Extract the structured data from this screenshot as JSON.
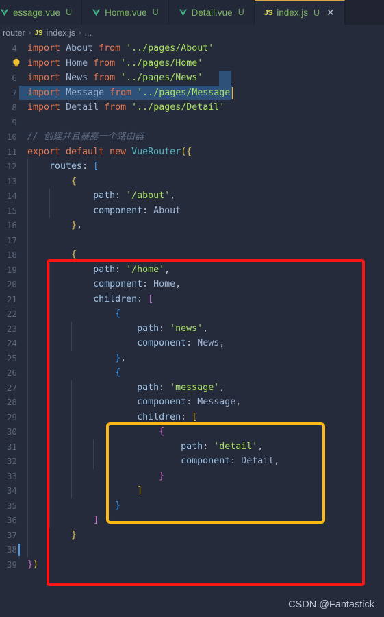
{
  "window": {
    "background_color": "#252b3a",
    "tabbar_background": "#1f2430"
  },
  "tabs": [
    {
      "label": "essage.vue",
      "badge": "U",
      "icon": "vue-icon",
      "active": false,
      "closable": false,
      "truncated_left": true
    },
    {
      "label": "Home.vue",
      "badge": "U",
      "icon": "vue-icon",
      "active": false,
      "closable": false,
      "truncated_left": false
    },
    {
      "label": "Detail.vue",
      "badge": "U",
      "icon": "vue-icon",
      "active": false,
      "closable": false,
      "truncated_left": false
    },
    {
      "label": "index.js",
      "badge": "U",
      "icon": "js-icon",
      "active": true,
      "closable": true,
      "close_glyph": "✕",
      "truncated_left": false
    }
  ],
  "breadcrumb": {
    "items": [
      "router",
      "index.js",
      "..."
    ],
    "js_badge": "JS",
    "separator": "›"
  },
  "editor": {
    "language": "javascript",
    "first_visible_line": 4,
    "lines": [
      {
        "n": 4,
        "text": "import About from '../pages/About'"
      },
      {
        "n": 5,
        "text": "import Home from '../pages/Home'"
      },
      {
        "n": 6,
        "text": "import News from '../pages/News'"
      },
      {
        "n": 7,
        "text": "import Message from '../pages/Message'"
      },
      {
        "n": 8,
        "text": "import Detail from '../pages/Detail'"
      },
      {
        "n": 9,
        "text": ""
      },
      {
        "n": 10,
        "text": "// 创建并且暴露一个路由器"
      },
      {
        "n": 11,
        "text": "export default new VueRouter({"
      },
      {
        "n": 12,
        "text": "    routes: ["
      },
      {
        "n": 13,
        "text": "        {"
      },
      {
        "n": 14,
        "text": "            path: '/about',"
      },
      {
        "n": 15,
        "text": "            component: About"
      },
      {
        "n": 16,
        "text": "        },"
      },
      {
        "n": 17,
        "text": ""
      },
      {
        "n": 18,
        "text": "        {"
      },
      {
        "n": 19,
        "text": "            path: '/home',"
      },
      {
        "n": 20,
        "text": "            component: Home,"
      },
      {
        "n": 21,
        "text": "            children: ["
      },
      {
        "n": 22,
        "text": "                {"
      },
      {
        "n": 23,
        "text": "                    path: 'news',"
      },
      {
        "n": 24,
        "text": "                    component: News,"
      },
      {
        "n": 25,
        "text": "                },"
      },
      {
        "n": 26,
        "text": "                {"
      },
      {
        "n": 27,
        "text": "                    path: 'message',"
      },
      {
        "n": 28,
        "text": "                    component: Message,"
      },
      {
        "n": 29,
        "text": "                    children: ["
      },
      {
        "n": 30,
        "text": "                        {"
      },
      {
        "n": 31,
        "text": "                            path: 'detail',"
      },
      {
        "n": 32,
        "text": "                            component: Detail,"
      },
      {
        "n": 33,
        "text": "                        }"
      },
      {
        "n": 34,
        "text": "                    ]"
      },
      {
        "n": 35,
        "text": "                }"
      },
      {
        "n": 36,
        "text": "            ]"
      },
      {
        "n": 37,
        "text": "        }"
      },
      {
        "n": 38,
        "text": ""
      },
      {
        "n": 39,
        "text": "})"
      }
    ],
    "selected_line": 7,
    "selection_color": "#2d5179",
    "cursor_color": "#dcb560",
    "lightbulb_line": 5
  },
  "annotations": {
    "red_box": {
      "color": "#fa1414",
      "label": "home-route-highlight"
    },
    "yellow_box": {
      "color": "#fcb913",
      "label": "nested-children-highlight"
    }
  },
  "watermark": {
    "text": "CSDN @Fantastick"
  }
}
